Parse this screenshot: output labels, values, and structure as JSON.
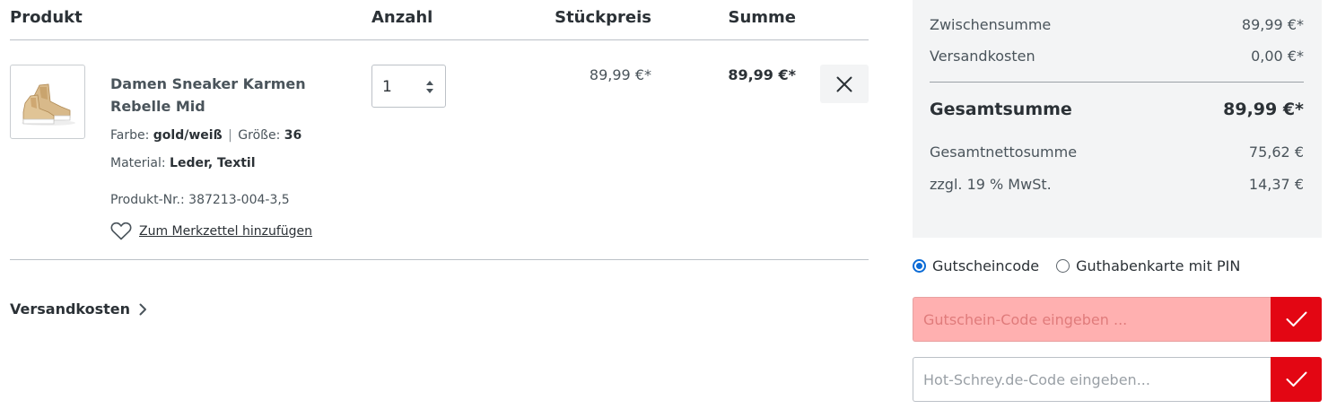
{
  "cart_table": {
    "headers": {
      "product": "Produkt",
      "quantity": "Anzahl",
      "unit_price": "Stückpreis",
      "total": "Summe"
    },
    "items": [
      {
        "name": "Damen Sneaker Karmen Rebelle Mid",
        "color_label": "Farbe:",
        "color_value": "gold/weiß",
        "size_label": "Größe:",
        "size_value": "36",
        "material_label": "Material:",
        "material_value": "Leder, Textil",
        "product_nr": "Produkt-Nr.: 387213-004-3,5",
        "wishlist_label": "Zum Merkzettel hinzufügen",
        "quantity": "1",
        "unit_price": "89,99 €*",
        "total": "89,99 €*",
        "icons": {
          "wishlist": "heart-icon",
          "remove": "close-icon",
          "spinner": "up-down-arrows-icon"
        }
      }
    ]
  },
  "shipping_link": {
    "label": "Versandkosten",
    "icon": "chevron-right-icon"
  },
  "summary": {
    "subtotal_label": "Zwischensumme",
    "subtotal_value": "89,99 €*",
    "shipping_label": "Versandkosten",
    "shipping_value": "0,00 €*",
    "total_label": "Gesamtsumme",
    "total_value": "89,99 €*",
    "net_label": "Gesamtnettosumme",
    "net_value": "75,62 €",
    "vat_label": "zzgl. 19 % MwSt.",
    "vat_value": "14,37 €"
  },
  "voucher": {
    "options": [
      "Gutscheincode",
      "Guthabenkarte mit PIN"
    ],
    "selected": "Gutscheincode",
    "code_placeholder": "Gutschein-Code eingeben ...",
    "hot_placeholder": "Hot-Schrey.de-Code eingeben...",
    "submit_icon": "checkmark-icon"
  },
  "colors": {
    "accent_red": "#e30613",
    "radio_blue": "#0b6bd6",
    "summary_bg": "#f3f4f5",
    "error_field_bg": "#ffb0b0"
  }
}
